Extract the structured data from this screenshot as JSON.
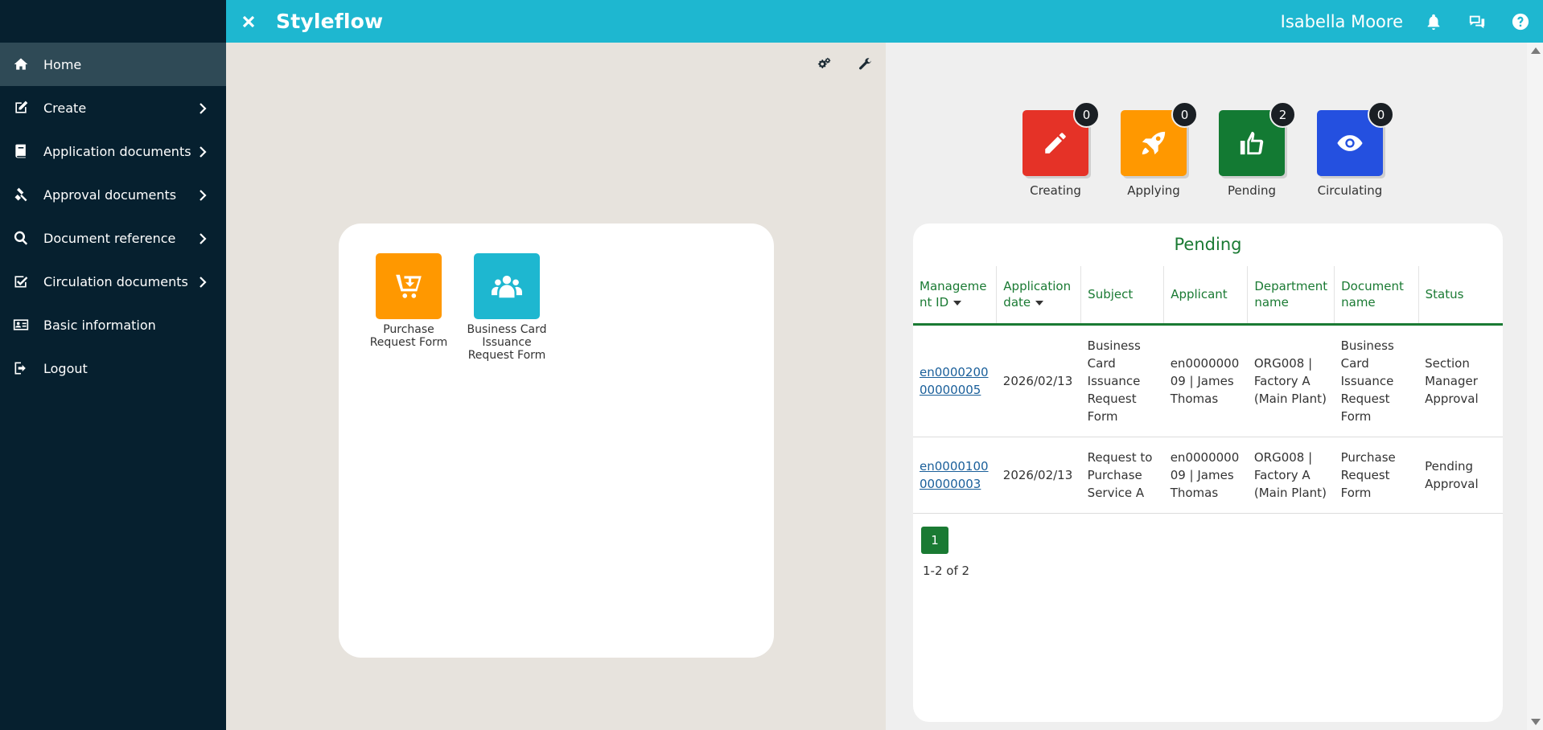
{
  "header": {
    "brand": "Styleflow",
    "user_name": "Isabella Moore"
  },
  "sidebar": {
    "items": [
      {
        "label": "Home",
        "icon": "home-icon"
      },
      {
        "label": "Create",
        "icon": "edit-icon"
      },
      {
        "label": "Application documents",
        "icon": "book-icon"
      },
      {
        "label": "Approval documents",
        "icon": "gavel-icon"
      },
      {
        "label": "Document reference",
        "icon": "search-icon"
      },
      {
        "label": "Circulation documents",
        "icon": "checkbox-icon"
      },
      {
        "label": "Basic information",
        "icon": "id-card-icon"
      },
      {
        "label": "Logout",
        "icon": "logout-icon"
      }
    ]
  },
  "forms": [
    {
      "label": "Purchase Request Form",
      "color": "#ff9800",
      "icon": "cart-icon"
    },
    {
      "label": "Business Card Issuance Request Form",
      "color": "#1eb7d0",
      "icon": "users-icon"
    }
  ],
  "status_tiles": [
    {
      "label": "Creating",
      "count": "0",
      "color": "#e53227",
      "icon": "pencil-icon"
    },
    {
      "label": "Applying",
      "count": "0",
      "color": "#ff9800",
      "icon": "rocket-icon"
    },
    {
      "label": "Pending",
      "count": "2",
      "color": "#137a33",
      "icon": "thumbs-up-icon"
    },
    {
      "label": "Circulating",
      "count": "0",
      "color": "#2450e0",
      "icon": "eye-icon"
    }
  ],
  "pending": {
    "title": "Pending",
    "columns": [
      "Manageme nt ID",
      "Application date",
      "Subject",
      "Applicant",
      "Department name",
      "Document name",
      "Status"
    ],
    "rows": [
      {
        "management_id": "en000020000000005",
        "application_date": "2026/02/13",
        "subject": "Business Card Issuance Request Form",
        "applicant": "en000000009 | James Thomas",
        "department": "ORG008 | Factory A (Main Plant)",
        "document_name": "Business Card Issuance Request Form",
        "status": "Section Manager Approval"
      },
      {
        "management_id": "en000010000000003",
        "application_date": "2026/02/13",
        "subject": "Request to Purchase Service A",
        "applicant": "en000000009 | James Thomas",
        "department": "ORG008 | Factory A (Main Plant)",
        "document_name": "Purchase Request Form",
        "status": "Pending Approval"
      }
    ],
    "current_page": "1",
    "range_text": "1-2 of 2"
  }
}
